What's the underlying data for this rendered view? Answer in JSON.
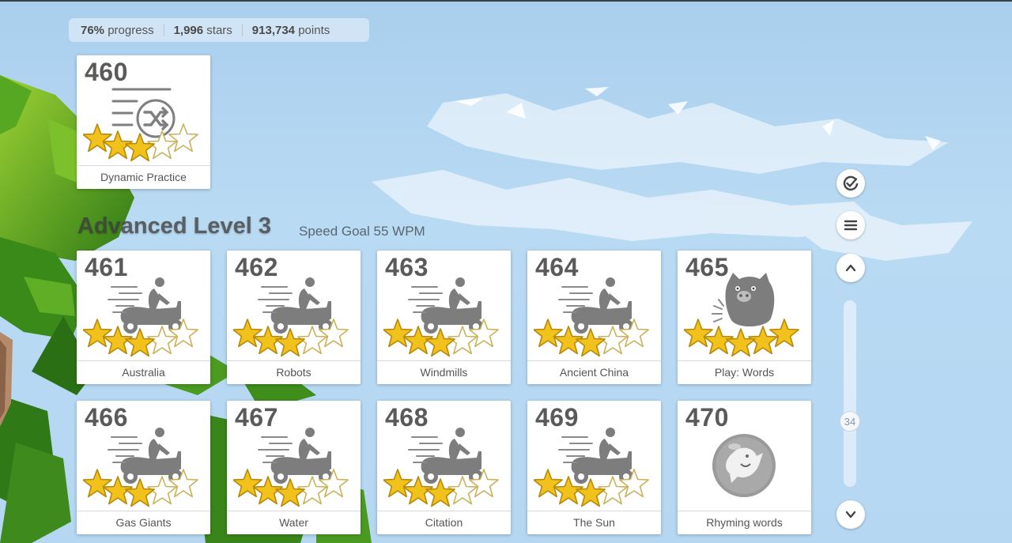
{
  "stats": {
    "progress_value": "76%",
    "progress_label": "progress",
    "stars_value": "1,996",
    "stars_label": "stars",
    "points_value": "913,734",
    "points_label": "points"
  },
  "practice_card": {
    "number": "460",
    "label": "Dynamic Practice",
    "stars_earned": 3,
    "stars_total": 5,
    "icon": "shuffle-list-icon"
  },
  "level": {
    "title": "Advanced Level 3",
    "subtitle": "Speed Goal 55 WPM"
  },
  "lessons": [
    {
      "number": "461",
      "label": "Australia",
      "stars_earned": 3,
      "stars_total": 5,
      "icon": "scooter-rider-icon"
    },
    {
      "number": "462",
      "label": "Robots",
      "stars_earned": 3,
      "stars_total": 5,
      "icon": "scooter-rider-icon"
    },
    {
      "number": "463",
      "label": "Windmills",
      "stars_earned": 3,
      "stars_total": 5,
      "icon": "scooter-rider-icon"
    },
    {
      "number": "464",
      "label": "Ancient China",
      "stars_earned": 3,
      "stars_total": 5,
      "icon": "scooter-rider-icon"
    },
    {
      "number": "465",
      "label": "Play: Words",
      "stars_earned": 5,
      "stars_total": 5,
      "icon": "monster-icon"
    },
    {
      "number": "466",
      "label": "Gas Giants",
      "stars_earned": 3,
      "stars_total": 5,
      "icon": "scooter-rider-icon"
    },
    {
      "number": "467",
      "label": "Water",
      "stars_earned": 3,
      "stars_total": 5,
      "icon": "scooter-rider-icon"
    },
    {
      "number": "468",
      "label": "Citation",
      "stars_earned": 3,
      "stars_total": 5,
      "icon": "scooter-rider-icon"
    },
    {
      "number": "469",
      "label": "The Sun",
      "stars_earned": 3,
      "stars_total": 5,
      "icon": "scooter-rider-icon"
    },
    {
      "number": "470",
      "label": "Rhyming words",
      "stars_earned": 0,
      "stars_total": 5,
      "icon": "game-bubble-icon"
    }
  ],
  "side_controls": {
    "buttons": [
      "check-progress-icon",
      "menu-icon",
      "chevron-up-icon",
      "chevron-down-icon"
    ],
    "scroll_position_label": "34"
  },
  "colors": {
    "star_gold": "#f2c21c",
    "icon_gray": "#7f7f7f",
    "number_gray": "#5a5a5a"
  }
}
